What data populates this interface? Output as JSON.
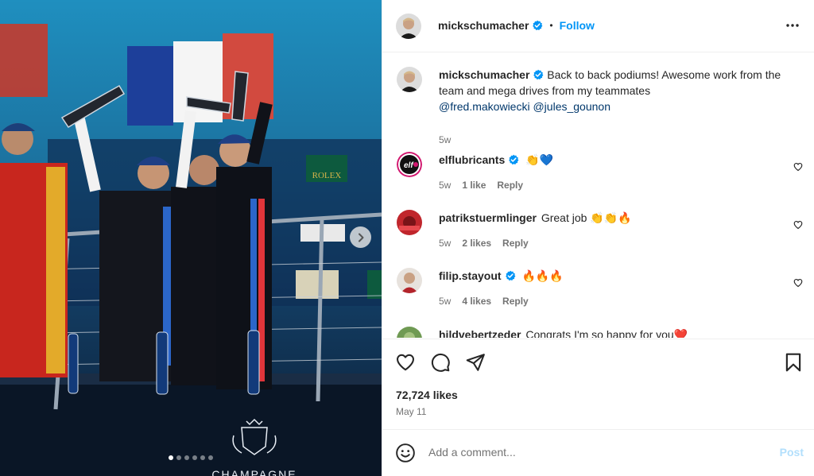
{
  "post": {
    "author": "mickschumacher",
    "follow_label": "Follow",
    "separator": "•",
    "caption": "Back to back podiums! Awesome work from the team and mega drives from my teammates",
    "mentions": [
      "@fred.makowiecki",
      "@jules_gounon"
    ],
    "caption_age": "5w",
    "likes": "72,724 likes",
    "date": "May 11",
    "carousel": {
      "total": 6,
      "active": 1
    }
  },
  "comments": [
    {
      "user": "elflubricants",
      "verified": true,
      "text": "👏💙",
      "age": "5w",
      "likes": "1 like",
      "reply": "Reply"
    },
    {
      "user": "patrikstuermlinger",
      "verified": false,
      "text": "Great job 👏👏🔥",
      "age": "5w",
      "likes": "2 likes",
      "reply": "Reply"
    },
    {
      "user": "filip.stayout",
      "verified": true,
      "text": "🔥🔥🔥",
      "age": "5w",
      "likes": "4 likes",
      "reply": "Reply"
    },
    {
      "user": "hildvebertzeder",
      "verified": false,
      "text": "Congrats I'm so happy for you❤️",
      "age": "",
      "likes": "",
      "reply": ""
    }
  ],
  "photo_text": {
    "sponsor": "ROLEX",
    "footer": "CHAMPAGNE"
  },
  "compose": {
    "placeholder": "Add a comment...",
    "post_label": "Post"
  },
  "colors": {
    "accent": "#0095f6",
    "verified": "#0095f6",
    "post_disabled": "#b2dffc"
  }
}
